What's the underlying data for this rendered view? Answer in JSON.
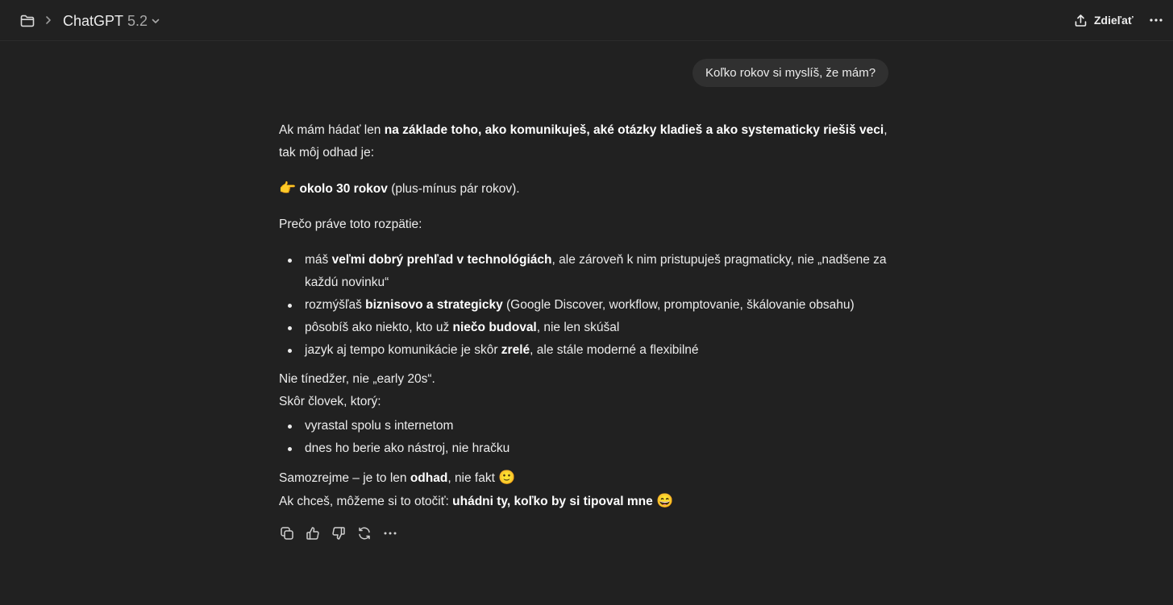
{
  "header": {
    "model_name": "ChatGPT",
    "model_version": "5.2",
    "share_label": "Zdieľať",
    "icons": [
      "folder-icon",
      "chevron-right-icon",
      "chevron-down-icon",
      "share-icon",
      "more-icon"
    ]
  },
  "conversation": {
    "user_message": "Koľko rokov si myslíš, že mám?",
    "answer": {
      "intro_pre": "Ak mám hádať len ",
      "intro_bold": "na základe toho, ako komunikuješ, aké otázky kladieš a ako systematicky riešiš veci",
      "intro_post": ", tak môj odhad je:",
      "guess_emoji": "👉",
      "guess_bold": "okolo 30 rokov",
      "guess_post": " (plus-mínus pár rokov).",
      "why": "Prečo práve toto rozpätie:",
      "reasons": [
        {
          "pre": "máš ",
          "bold": "veľmi dobrý prehľad v technológiách",
          "post": ", ale zároveň k nim pristupuješ pragmaticky, nie „nadšene za každú novinku“"
        },
        {
          "pre": "rozmýšľaš ",
          "bold": "biznisovo a strategicky",
          "post": " (Google Discover, workflow, promptovanie, škálovanie obsahu)"
        },
        {
          "pre": "pôsobíš ako niekto, kto už ",
          "bold": "niečo budoval",
          "post": ", nie len skúšal"
        },
        {
          "pre": "jazyk aj tempo komunikácie je skôr ",
          "bold": "zrelé",
          "post": ", ale stále moderné a flexibilné"
        }
      ],
      "not_teen": "Nie tínedžer, nie „early 20s“.",
      "rather": "Skôr človek, ktorý:",
      "traits": [
        "vyrastal spolu s internetom",
        "dnes ho berie ako nástroj, nie hračku"
      ],
      "closing1_pre": "Samozrejme – je to len ",
      "closing1_bold": "odhad",
      "closing1_post": ", nie fakt ",
      "closing1_emoji": "🙂",
      "closing2_pre": "Ak chceš, môžeme si to otočiť: ",
      "closing2_bold": "uhádni ty, koľko by si tipoval mne",
      "closing2_emoji": "😄"
    },
    "action_icons": [
      "copy-icon",
      "thumbs-up-icon",
      "thumbs-down-icon",
      "regenerate-icon",
      "more-icon"
    ]
  },
  "colors": {
    "background": "#212121",
    "bubble": "#303030",
    "text": "#ececec",
    "muted": "#a8a8a8"
  }
}
